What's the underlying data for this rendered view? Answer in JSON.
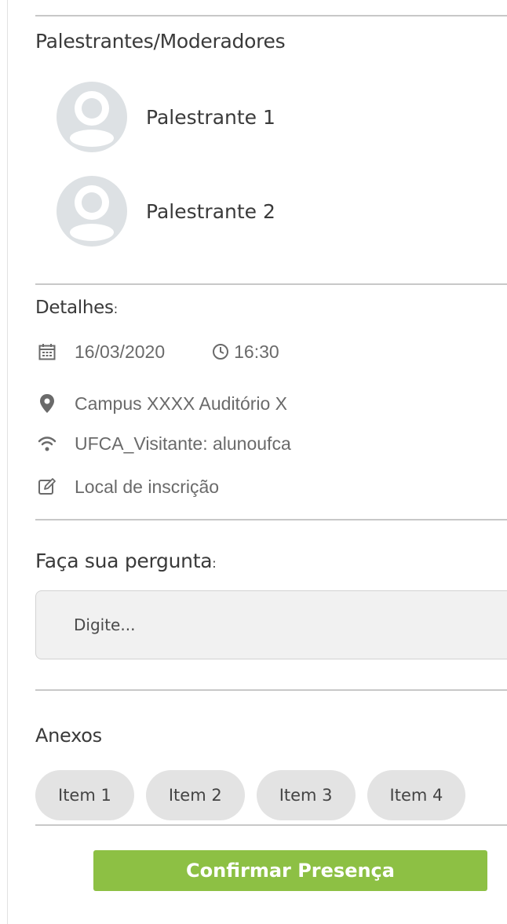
{
  "speakers": {
    "heading": "Palestrantes/Moderadores",
    "items": [
      {
        "name": "Palestrante 1"
      },
      {
        "name": "Palestrante 2"
      }
    ]
  },
  "details": {
    "heading": "Detalhes",
    "heading_colon": ":",
    "date": "16/03/2020",
    "time": "16:30",
    "location": "Campus XXXX Auditório X",
    "wifi": "UFCA_Visitante: alunoufca",
    "registration": "Local de inscrição"
  },
  "question": {
    "heading": "Faça sua pergunta",
    "heading_colon": ":",
    "placeholder": "Digite..."
  },
  "attachments": {
    "heading": "Anexos",
    "items": [
      "Item 1",
      "Item 2",
      "Item 3",
      "Item 4"
    ]
  },
  "confirm_button": "Confirmar Presença",
  "colors": {
    "accent": "#8dc044",
    "avatar": "#dde1e4",
    "icon": "#6a6a6a"
  }
}
